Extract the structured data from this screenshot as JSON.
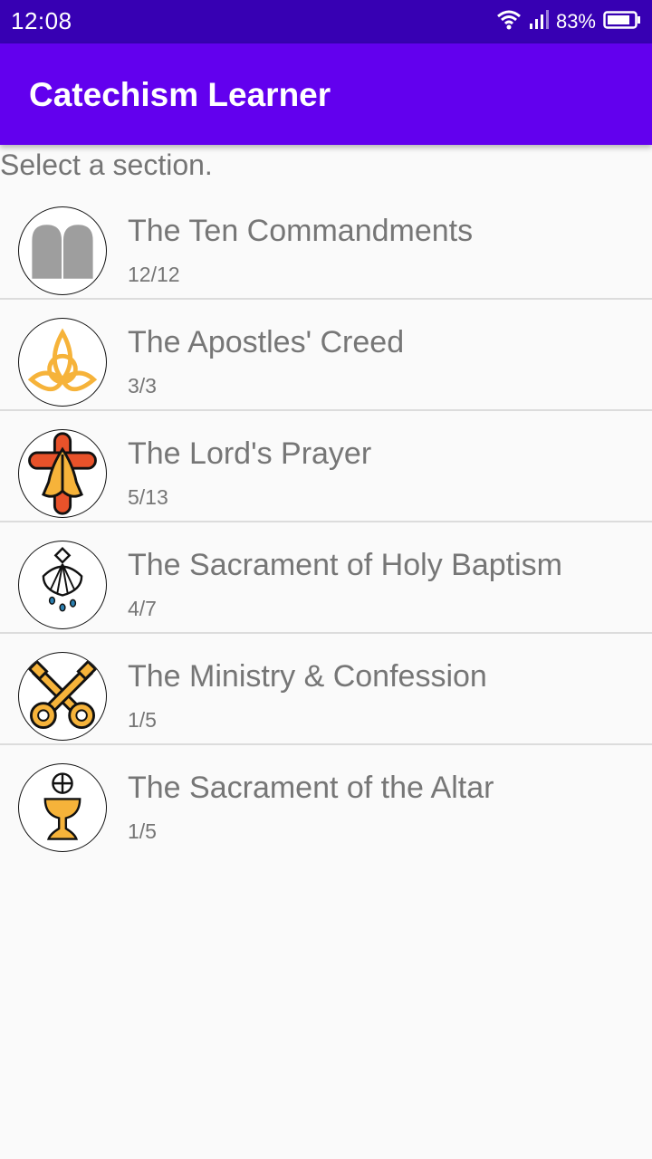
{
  "status_bar": {
    "time": "12:08",
    "battery": "83%",
    "icons": [
      "wifi-icon",
      "signal-icon",
      "battery-icon"
    ]
  },
  "app_bar": {
    "title": "Catechism Learner"
  },
  "prompt": "Select a section.",
  "sections": [
    {
      "title": "The Ten Commandments",
      "progress": "12/12",
      "icon": "tablets-icon"
    },
    {
      "title": "The Apostles' Creed",
      "progress": "3/3",
      "icon": "trinity-knot-icon"
    },
    {
      "title": "The Lord's Prayer",
      "progress": "5/13",
      "icon": "praying-hands-cross-icon"
    },
    {
      "title": "The Sacrament of Holy Baptism",
      "progress": "4/7",
      "icon": "baptism-shell-icon"
    },
    {
      "title": "The Ministry & Confession",
      "progress": "1/5",
      "icon": "crossed-keys-icon"
    },
    {
      "title": "The Sacrament of the Altar",
      "progress": "1/5",
      "icon": "chalice-host-icon"
    }
  ],
  "colors": {
    "status_bar": "#3700b3",
    "app_bar": "#6200ee",
    "background": "#fafafa",
    "text_secondary": "#757575"
  }
}
